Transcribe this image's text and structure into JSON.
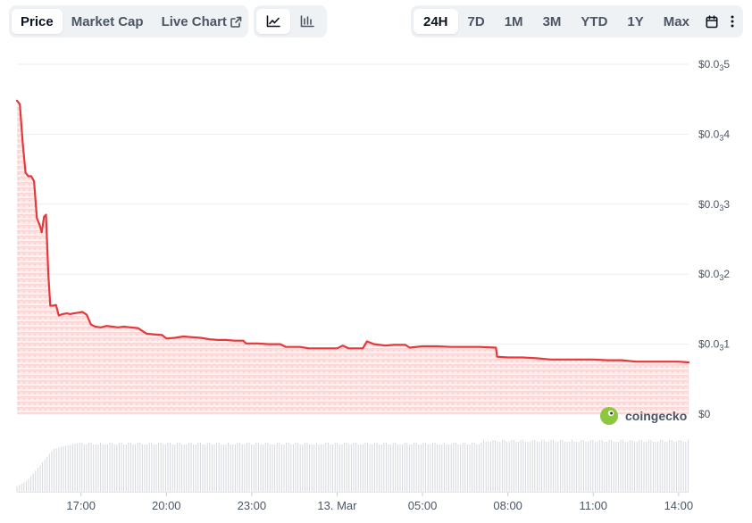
{
  "toolbar": {
    "metric_tabs": [
      {
        "label": "Price",
        "active": true
      },
      {
        "label": "Market Cap",
        "active": false
      },
      {
        "label": "Live Chart",
        "active": false,
        "icon": "external-link-icon"
      }
    ],
    "chart_type_buttons": [
      {
        "icon": "line-chart-icon",
        "active": true
      },
      {
        "icon": "candlestick-icon",
        "active": false
      }
    ],
    "ranges": [
      {
        "label": "24H",
        "active": true
      },
      {
        "label": "7D",
        "active": false
      },
      {
        "label": "1M",
        "active": false
      },
      {
        "label": "3M",
        "active": false
      },
      {
        "label": "YTD",
        "active": false
      },
      {
        "label": "1Y",
        "active": false
      },
      {
        "label": "Max",
        "active": false
      }
    ],
    "extra_icons": [
      "calendar-icon",
      "more-vertical-icon"
    ]
  },
  "watermark": {
    "text": "coingecko",
    "icon": "coingecko-logo-icon"
  },
  "colors": {
    "line": "#e5383b",
    "area_fill": "#fde2e2",
    "grid": "#eceef1",
    "volume": "#d4d7dc",
    "logo": "#8dc63f"
  },
  "chart_data": {
    "type": "line",
    "y_ticks": [
      {
        "value": 5e-06,
        "label": "$0.0",
        "sub": "3",
        "tail": "5"
      },
      {
        "value": 4e-06,
        "label": "$0.0",
        "sub": "3",
        "tail": "4"
      },
      {
        "value": 3e-06,
        "label": "$0.0",
        "sub": "3",
        "tail": "3"
      },
      {
        "value": 2e-06,
        "label": "$0.0",
        "sub": "3",
        "tail": "2"
      },
      {
        "value": 1e-06,
        "label": "$0.0",
        "sub": "3",
        "tail": "1"
      },
      {
        "value": 0,
        "label": "$0",
        "sub": "",
        "tail": ""
      }
    ],
    "ylim": [
      0,
      5e-06
    ],
    "xlim": [
      14.75,
      38.35
    ],
    "x_ticks": [
      {
        "hour": 17,
        "label": "17:00"
      },
      {
        "hour": 20,
        "label": "20:00"
      },
      {
        "hour": 23,
        "label": "23:00"
      },
      {
        "hour": 26,
        "label": "13. Mar"
      },
      {
        "hour": 29,
        "label": "05:00"
      },
      {
        "hour": 32,
        "label": "08:00"
      },
      {
        "hour": 35,
        "label": "11:00"
      },
      {
        "hour": 38,
        "label": "14:00"
      }
    ],
    "grid": true,
    "series": [
      {
        "points": [
          [
            14.75,
            4.48e-06
          ],
          [
            14.85,
            4.43e-06
          ],
          [
            14.95,
            3.88e-06
          ],
          [
            15.05,
            3.45e-06
          ],
          [
            15.15,
            3.4e-06
          ],
          [
            15.25,
            3.4e-06
          ],
          [
            15.35,
            3.33e-06
          ],
          [
            15.45,
            2.8e-06
          ],
          [
            15.55,
            2.7e-06
          ],
          [
            15.62,
            2.6e-06
          ],
          [
            15.7,
            2.82e-06
          ],
          [
            15.77,
            2.85e-06
          ],
          [
            15.85,
            2e-06
          ],
          [
            15.92,
            1.55e-06
          ],
          [
            16.02,
            1.55e-06
          ],
          [
            16.12,
            1.56e-06
          ],
          [
            16.22,
            1.41e-06
          ],
          [
            16.35,
            1.43e-06
          ],
          [
            16.5,
            1.44e-06
          ],
          [
            16.62,
            1.43e-06
          ],
          [
            16.75,
            1.44e-06
          ],
          [
            16.9,
            1.45e-06
          ],
          [
            17.05,
            1.46e-06
          ],
          [
            17.2,
            1.42e-06
          ],
          [
            17.35,
            1.28e-06
          ],
          [
            17.5,
            1.25e-06
          ],
          [
            17.7,
            1.24e-06
          ],
          [
            17.9,
            1.26e-06
          ],
          [
            18.1,
            1.25e-06
          ],
          [
            18.3,
            1.24e-06
          ],
          [
            18.5,
            1.25e-06
          ],
          [
            18.75,
            1.24e-06
          ],
          [
            19.0,
            1.23e-06
          ],
          [
            19.3,
            1.15e-06
          ],
          [
            19.55,
            1.14e-06
          ],
          [
            19.85,
            1.13e-06
          ],
          [
            20.0,
            1.08e-06
          ],
          [
            20.3,
            1.09e-06
          ],
          [
            20.6,
            1.11e-06
          ],
          [
            20.9,
            1.1e-06
          ],
          [
            21.2,
            1.09e-06
          ],
          [
            21.5,
            1.07e-06
          ],
          [
            21.8,
            1.06e-06
          ],
          [
            22.1,
            1.06e-06
          ],
          [
            22.4,
            1.05e-06
          ],
          [
            22.7,
            1.05e-06
          ],
          [
            22.8,
            1.01e-06
          ],
          [
            23.2,
            1.01e-06
          ],
          [
            23.6,
            1e-06
          ],
          [
            24.0,
            1e-06
          ],
          [
            24.2,
            9.6e-07
          ],
          [
            24.7,
            9.6e-07
          ],
          [
            25.0,
            9.4e-07
          ],
          [
            25.5,
            9.4e-07
          ],
          [
            26.0,
            9.4e-07
          ],
          [
            26.2,
            9.8e-07
          ],
          [
            26.4,
            9.4e-07
          ],
          [
            26.9,
            9.4e-07
          ],
          [
            27.05,
            1.04e-06
          ],
          [
            27.3,
            1e-06
          ],
          [
            27.7,
            9.8e-07
          ],
          [
            28.0,
            9.9e-07
          ],
          [
            28.4,
            9.9e-07
          ],
          [
            28.55,
            9.5e-07
          ],
          [
            29.0,
            9.7e-07
          ],
          [
            29.5,
            9.7e-07
          ],
          [
            30.0,
            9.6e-07
          ],
          [
            30.5,
            9.6e-07
          ],
          [
            31.0,
            9.6e-07
          ],
          [
            31.58,
            9.5e-07
          ],
          [
            31.62,
            8.2e-07
          ],
          [
            32.0,
            8.1e-07
          ],
          [
            32.5,
            8.1e-07
          ],
          [
            33.0,
            8e-07
          ],
          [
            33.5,
            7.8e-07
          ],
          [
            34.0,
            7.8e-07
          ],
          [
            34.5,
            7.8e-07
          ],
          [
            35.0,
            7.8e-07
          ],
          [
            35.5,
            7.7e-07
          ],
          [
            36.0,
            7.7e-07
          ],
          [
            36.5,
            7.5e-07
          ],
          [
            37.0,
            7.5e-07
          ],
          [
            37.5,
            7.5e-07
          ],
          [
            38.0,
            7.5e-07
          ],
          [
            38.35,
            7.4e-07
          ]
        ]
      }
    ]
  }
}
